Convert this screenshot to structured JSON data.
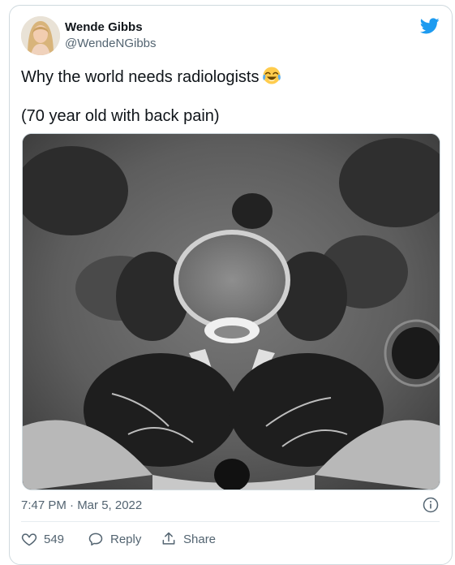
{
  "author": {
    "name": "Wende Gibbs",
    "handle": "@WendeNGibbs"
  },
  "tweet": {
    "line1": "Why the world needs radiologists",
    "emoji": "face-with-tears-of-joy",
    "line2": "(70 year old with back pain)",
    "media": "axial MRI scan of lumbar spine"
  },
  "meta": {
    "timestamp": "7:47 PM · Mar 5, 2022"
  },
  "actions": {
    "like_count": "549",
    "reply_label": "Reply",
    "share_label": "Share"
  },
  "colors": {
    "twitter_blue": "#1d9bf0",
    "text_primary": "#0f1419",
    "text_secondary": "#536471",
    "border": "#cfd9de"
  }
}
